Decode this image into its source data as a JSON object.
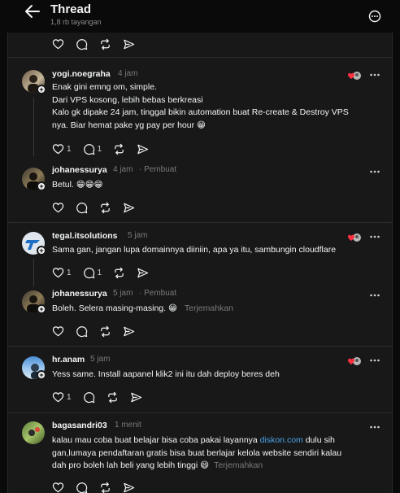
{
  "header": {
    "title": "Thread",
    "views": "1,8 rb tayangan"
  },
  "posts": [
    {
      "username": "yogi.noegraha",
      "time": "4 jam",
      "lines": [
        "Enak gini emng om, simple.",
        "Dari VPS kosong, lebih bebas berkreasi",
        "Kalo gk dipake 24 jam, tinggal bikin automation buat Re-create & Destroy VPS",
        "nya. Biar hemat pake yg pay per hour 😁"
      ],
      "likes": "1",
      "replies": "1"
    },
    {
      "username": "johanessurya",
      "time": "4 jam",
      "author_tag": "· Pembuat",
      "text": "Betul. 😁😁😁"
    },
    {
      "username": "tegal.itsolutions",
      "time": "5 jam",
      "text": "Sama gan, jangan lupa domainnya diiniin, apa ya itu, sambungin cloudflare",
      "likes": "1",
      "replies": "1"
    },
    {
      "username": "johanessurya",
      "time": "5 jam",
      "author_tag": "· Pembuat",
      "text": "Boleh. Selera masing-masing. 😁",
      "translate": "Terjemahkan"
    },
    {
      "username": "hr.anam",
      "time": "5 jam",
      "text": "Yess same. Install aapanel klik2 ini itu dah deploy beres deh",
      "likes": "1"
    },
    {
      "username": "bagasandri03",
      "time": "1 menit",
      "text_before_link": "kalau mau coba buat belajar bisa coba pakai layannya ",
      "link": "diskon.com",
      "text_after_link": " dulu sih",
      "line2": "gan,lumaya pendaftaran gratis bisa buat berlajar kelola website sendiri kalau",
      "line3": "dah pro boleh lah beli yang lebih tinggi 😄",
      "translate": "Terjemahkan"
    }
  ],
  "icons": {
    "back": "arrow-left-icon",
    "more": "more-circle-icon",
    "ellipsis": "ellipsis-icon",
    "like": "heart-icon",
    "reply": "comment-icon",
    "repost": "repost-icon",
    "share": "send-icon"
  },
  "colors": {
    "background": "#0a0a0a",
    "panel": "#181818",
    "link": "#4aa3e6",
    "muted": "#7a7a7a",
    "like_red": "#ff3040"
  }
}
